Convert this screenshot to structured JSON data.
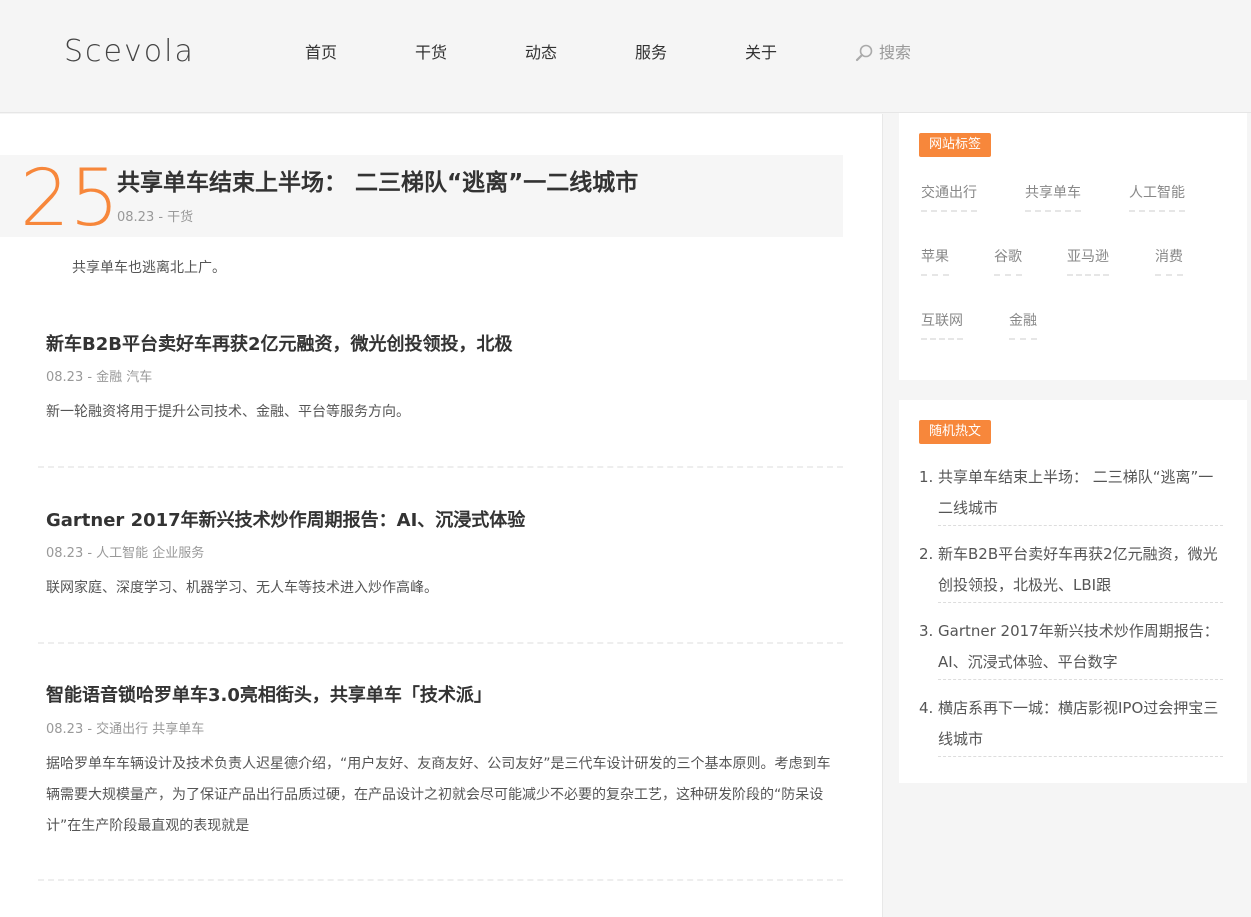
{
  "header": {
    "logo": "Scevola",
    "nav": [
      "首页",
      "干货",
      "动态",
      "服务",
      "关于"
    ],
    "search_label": "搜索"
  },
  "featured": {
    "day": "25",
    "title": "共享单车结束上半场： 二三梯队“逃离”一二线城市",
    "meta": "08.23 - 干货",
    "excerpt": "共享单车也逃离北上广。"
  },
  "posts": [
    {
      "title": "新车B2B平台卖好车再获2亿元融资，微光创投领投，北极",
      "meta": "08.23 - 金融 汽车",
      "excerpt": "新一轮融资将用于提升公司技术、金融、平台等服务方向。"
    },
    {
      "title": "Gartner 2017年新兴技术炒作周期报告：AI、沉浸式体验",
      "meta": "08.23 - 人工智能 企业服务",
      "excerpt": "联网家庭、深度学习、机器学习、无人车等技术进入炒作高峰。"
    },
    {
      "title": "智能语音锁哈罗单车3.0亮相街头，共享单车「技术派」",
      "meta": "08.23 - 交通出行 共享单车",
      "excerpt": "据哈罗单车车辆设计及技术负责人迟星德介绍，“用户友好、友商友好、公司友好”是三代车设计研发的三个基本原则。考虑到车辆需要大规模量产，为了保证产品出行品质过硬，在产品设计之初就会尽可能减少不必要的复杂工艺，这种研发阶段的“防呆设计”在生产阶段最直观的表现就是"
    }
  ],
  "sidebar": {
    "tags_title": "网站标签",
    "tags": [
      "交通出行",
      "共享单车",
      "人工智能",
      "苹果",
      "谷歌",
      "亚马逊",
      "消费",
      "互联网",
      "金融"
    ],
    "hot_title": "随机热文",
    "hot": [
      {
        "num": "1.",
        "text": "共享单车结束上半场： 二三梯队“逃离”一二线城市"
      },
      {
        "num": "2.",
        "text": "新车B2B平台卖好车再获2亿元融资，微光创投领投，北极光、LBI跟"
      },
      {
        "num": "3.",
        "text": "Gartner 2017年新兴技术炒作周期报告：AI、沉浸式体验、平台数字"
      },
      {
        "num": "4.",
        "text": "横店系再下一城：横店影视IPO过会押宝三线城市"
      }
    ]
  },
  "colors": {
    "accent": "#f7873b"
  }
}
